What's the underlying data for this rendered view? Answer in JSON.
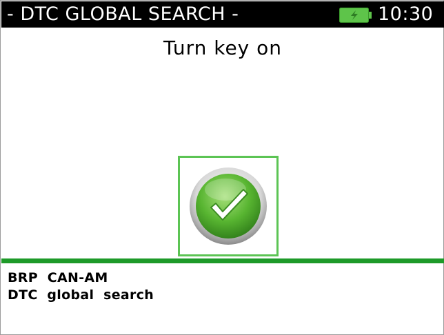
{
  "header": {
    "title": "- DTC GLOBAL SEARCH -",
    "time": "10:30",
    "battery_icon": "battery-charging-icon"
  },
  "main": {
    "prompt": "Turn key on",
    "confirm_icon": "checkmark-icon"
  },
  "footer": {
    "line1": "BRP  CAN-AM",
    "line2": "DTC  global  search"
  },
  "colors": {
    "title_bg": "#000000",
    "accent_green": "#1e9a29",
    "button_border": "#5cc454",
    "battery_fill": "#5ec44a"
  }
}
